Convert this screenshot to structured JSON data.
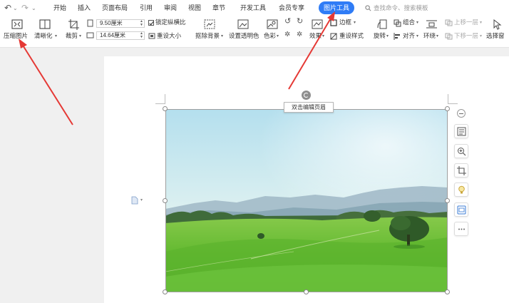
{
  "quick_access": {
    "undo": "↶",
    "redo": "↷",
    "more": "⌄"
  },
  "menu": {
    "items": [
      "开始",
      "插入",
      "页面布局",
      "引用",
      "审阅",
      "视图",
      "章节",
      "开发工具",
      "会员专享"
    ],
    "active_tab": "图片工具",
    "search_placeholder": "查找命令、搜索模板"
  },
  "ribbon": {
    "compress": "压缩图片",
    "clarity": "清晰化",
    "crop": "裁剪",
    "width_value": "9.50厘米",
    "height_value": "14.64厘米",
    "lock_ratio": "锁定纵横比",
    "reset_size": "重设大小",
    "remove_bg": "抠除背景",
    "set_transparent": "设置透明色",
    "color": "色彩",
    "border": "边框",
    "effect": "效果",
    "reset_style": "重设样式",
    "rotate": "旋转",
    "group": "组合",
    "align": "对齐",
    "wrap": "环绕",
    "bring_forward": "上移一层",
    "send_backward": "下移一层",
    "select_pane": "选择窗"
  },
  "tooltip": {
    "text": "双击编辑页眉"
  },
  "colors": {
    "accent": "#2f7cf6",
    "arrow": "#e53935",
    "sky_top": "#b9e1ee",
    "grass": "#6cc23c"
  }
}
